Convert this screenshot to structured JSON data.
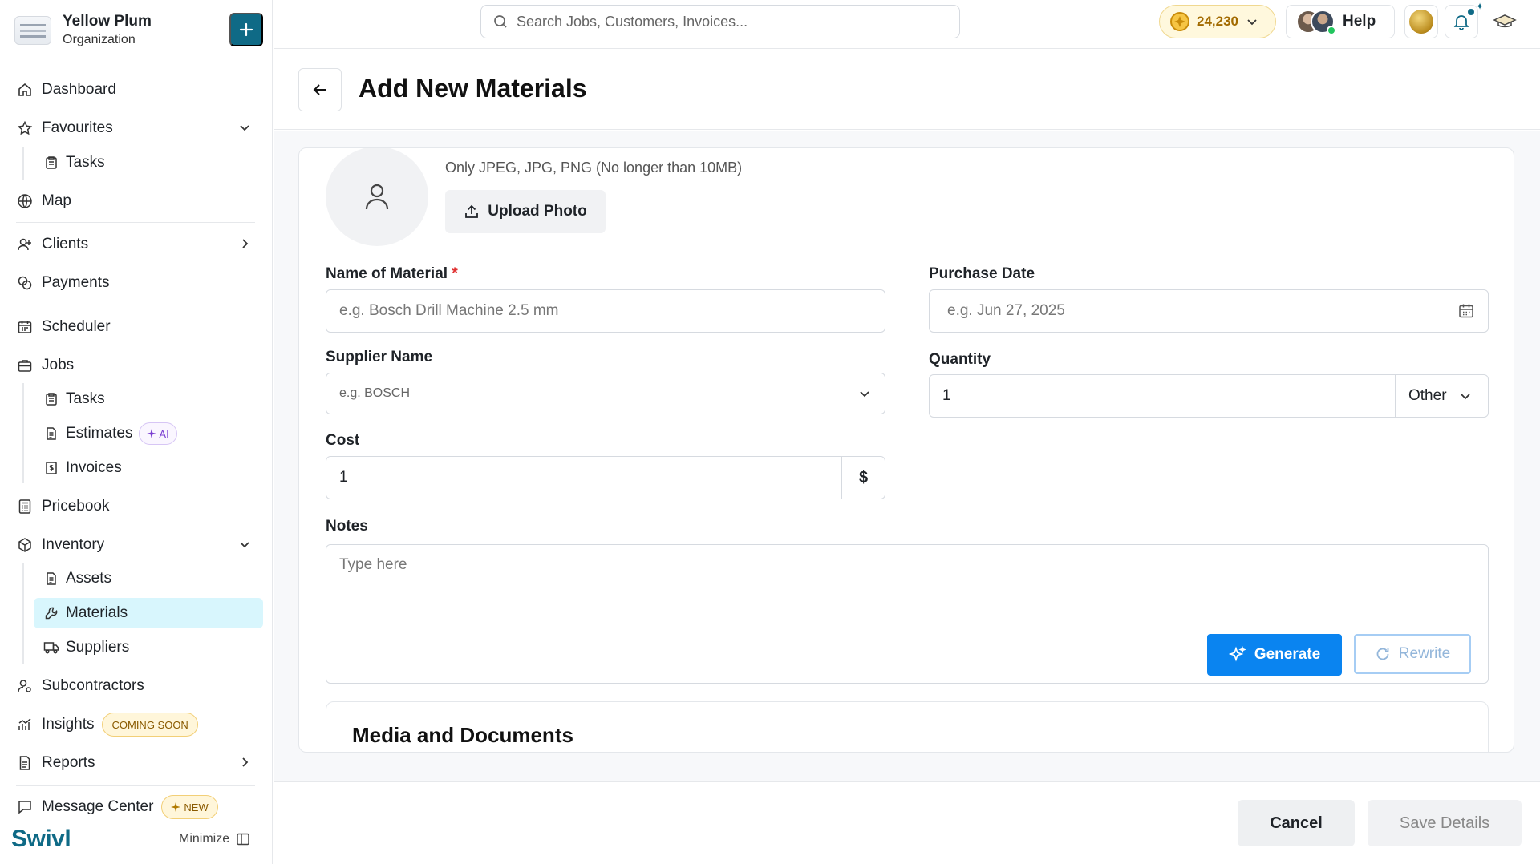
{
  "org": {
    "name": "Yellow Plum",
    "subtitle": "Organization"
  },
  "sidebar": {
    "dashboard": "Dashboard",
    "favourites": "Favourites",
    "favourites_tasks": "Tasks",
    "map": "Map",
    "clients": "Clients",
    "payments": "Payments",
    "scheduler": "Scheduler",
    "jobs": "Jobs",
    "jobs_tasks": "Tasks",
    "estimates": "Estimates",
    "estimates_badge": "AI",
    "invoices": "Invoices",
    "pricebook": "Pricebook",
    "inventory": "Inventory",
    "assets": "Assets",
    "materials": "Materials",
    "suppliers": "Suppliers",
    "subcontractors": "Subcontractors",
    "insights": "Insights",
    "insights_badge": "COMING SOON",
    "reports": "Reports",
    "message_center": "Message Center",
    "message_badge": "NEW",
    "brand": "Swivl",
    "minimize": "Minimize"
  },
  "topbar": {
    "search_placeholder": "Search Jobs, Customers, Invoices...",
    "coins": "24,230",
    "help": "Help"
  },
  "page": {
    "title": "Add New Materials"
  },
  "form": {
    "upload_hint": "Only JPEG, JPG, PNG (No longer than 10MB)",
    "upload_button": "Upload Photo",
    "name_label": "Name of Material",
    "name_required": "*",
    "name_placeholder": "e.g. Bosch Drill Machine 2.5 mm",
    "purchase_date_label": "Purchase Date",
    "purchase_date_placeholder": "e.g. Jun 27, 2025",
    "supplier_label": "Supplier Name",
    "supplier_placeholder": "e.g. BOSCH",
    "quantity_label": "Quantity",
    "quantity_value": "1",
    "quantity_unit": "Other",
    "cost_label": "Cost",
    "cost_value": "1",
    "cost_currency": "$",
    "notes_label": "Notes",
    "notes_placeholder": "Type here",
    "generate_button": "Generate",
    "rewrite_button": "Rewrite",
    "media_title": "Media and Documents"
  },
  "footer": {
    "cancel": "Cancel",
    "save": "Save Details"
  },
  "colors": {
    "accent": "#0f6a86",
    "primary_button": "#0a84f0",
    "active_nav": "#d8f6fd"
  }
}
